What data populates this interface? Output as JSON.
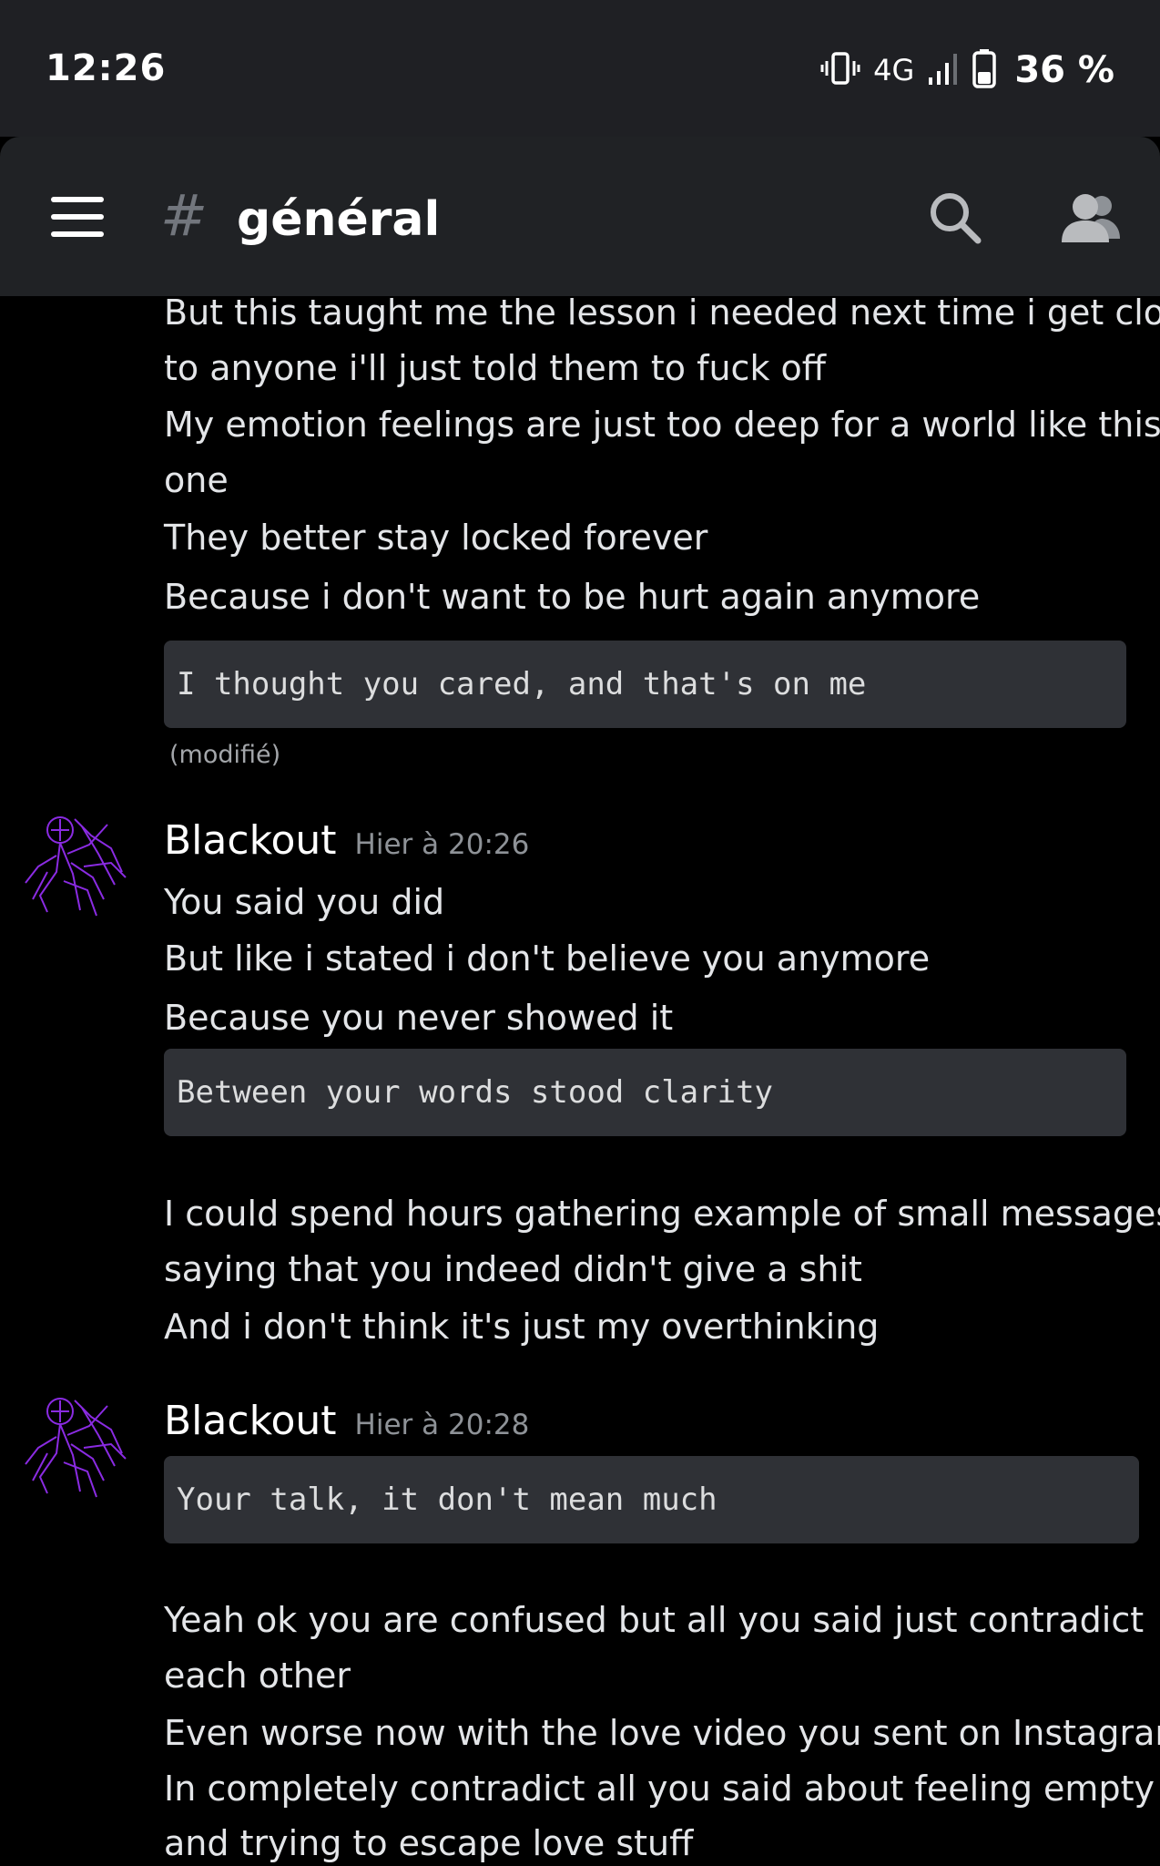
{
  "status_bar": {
    "time": "12:26",
    "network": "4G",
    "battery": "36 %",
    "icons": [
      "vibrate-icon",
      "signal-icon",
      "battery-icon"
    ]
  },
  "header": {
    "hash": "#",
    "channel_name": "général",
    "icons": [
      "menu-icon",
      "search-icon",
      "members-icon"
    ]
  },
  "messages": {
    "m1": {
      "lines": [
        "But this taught me the lesson i needed next time i get close",
        "to anyone i'll just told them to fuck off",
        "My emotion feelings are just too deep for a world like this",
        "one",
        "They better stay locked forever",
        "Because i don't want to be hurt again anymore"
      ],
      "code": "I thought you cared, and that's on me",
      "edited": "(modifié)"
    },
    "m2": {
      "author": "Blackout",
      "timestamp": "Hier à 20:26",
      "lines": [
        "You said you did",
        "But like i stated i don't believe you anymore",
        "Because you never showed it"
      ],
      "code": "Between your words stood clarity",
      "lines_after": [
        "I could spend hours gathering example of small messages",
        "saying that you indeed didn't give a shit",
        "And i don't think it's just my overthinking"
      ]
    },
    "m3": {
      "author": "Blackout",
      "timestamp": "Hier à 20:28",
      "code": "Your talk, it don't mean much",
      "lines_after": [
        "Yeah ok you are confused but all you said just contradict",
        "each other",
        "Even worse now with the love video you sent on Instagram",
        "In completely contradict all you said about feeling empty",
        "and trying to escape love stuff"
      ]
    }
  },
  "colors": {
    "background": "#000000",
    "header_bg": "#202225",
    "codeblock_bg": "#2f3136",
    "avatar_accent": "#8a2be2"
  }
}
